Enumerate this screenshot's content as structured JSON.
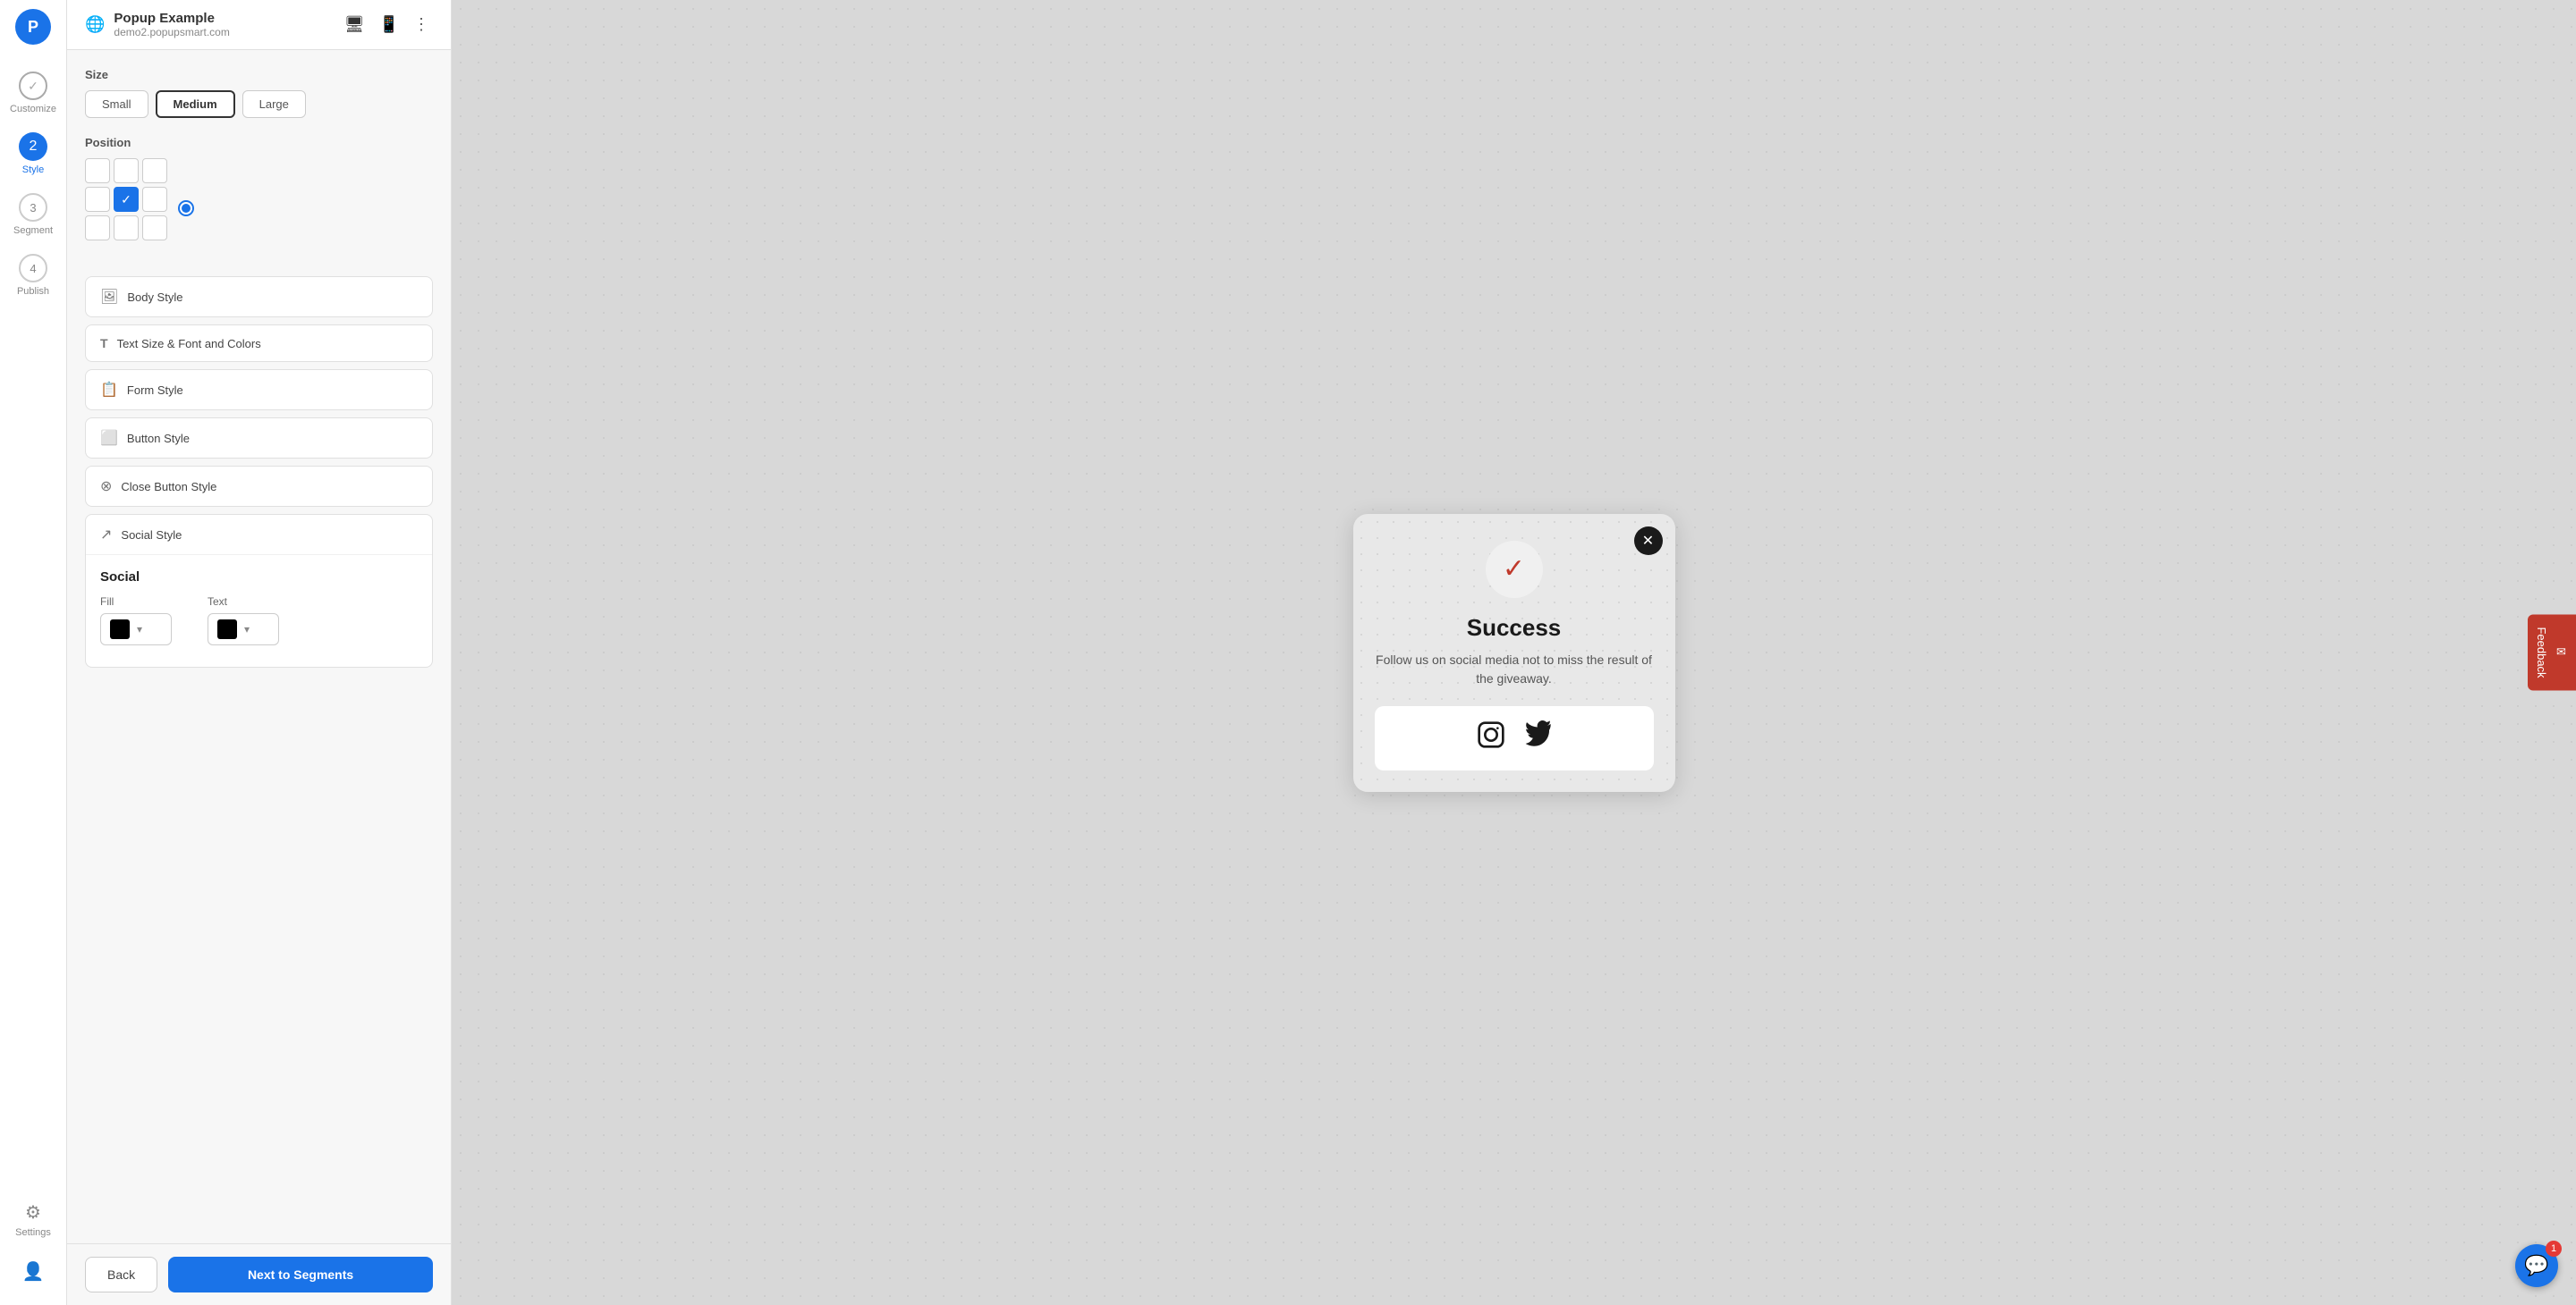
{
  "app": {
    "logo": "P",
    "title": "Popup Example",
    "subtitle": "demo2.popupsmart.com"
  },
  "sidebar": {
    "items": [
      {
        "step": "✓",
        "label": "Customize",
        "active": false,
        "check": true
      },
      {
        "step": "2",
        "label": "Style",
        "active": true
      },
      {
        "step": "3",
        "label": "Segment",
        "active": false
      },
      {
        "step": "4",
        "label": "Publish",
        "active": false
      }
    ],
    "settings_label": "Settings"
  },
  "panel": {
    "size_label": "Size",
    "size_options": [
      "Small",
      "Medium",
      "Large"
    ],
    "size_active": "Medium",
    "position_label": "Position",
    "style_items": [
      {
        "icon": "🖼",
        "label": "Body Style"
      },
      {
        "icon": "T",
        "label": "Text Size & Font and Colors"
      },
      {
        "icon": "📋",
        "label": "Form Style"
      },
      {
        "icon": "⬜",
        "label": "Button Style"
      },
      {
        "icon": "⊗",
        "label": "Close Button Style"
      }
    ],
    "social_style": {
      "header_icon": "↗",
      "header_label": "Social Style",
      "section_title": "Social",
      "fill_label": "Fill",
      "text_label": "Text",
      "fill_color": "#000000",
      "text_color": "#000000"
    },
    "footer": {
      "back_label": "Back",
      "next_label": "Next to Segments"
    }
  },
  "popup": {
    "close_icon": "✕",
    "check_icon": "✓",
    "title": "Success",
    "description": "Follow us on social media not to miss the result of the giveaway.",
    "social_icons": [
      "instagram",
      "twitter"
    ]
  },
  "feedback": {
    "label": "Feedback",
    "icon": "✉"
  },
  "chat": {
    "icon": "💬",
    "badge": "1"
  }
}
